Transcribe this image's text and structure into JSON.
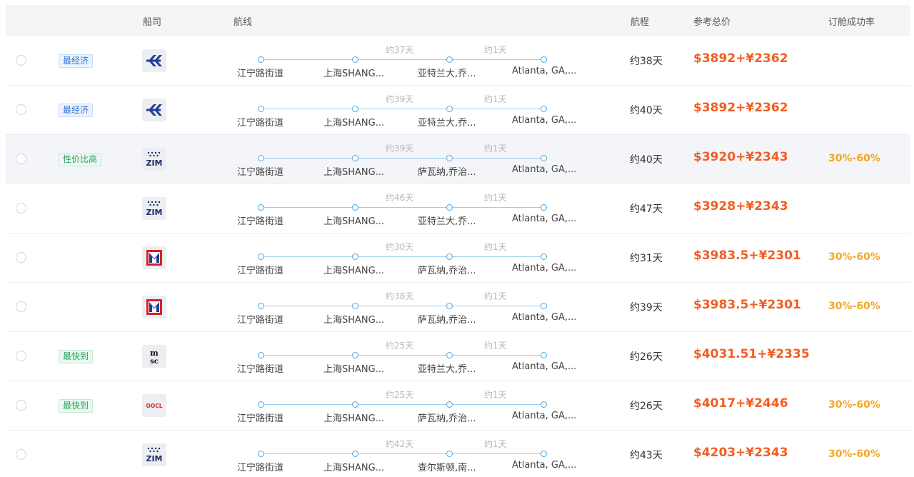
{
  "header": {
    "carrier": "船司",
    "route": "航线",
    "voyage": "航程",
    "price": "参考总价",
    "rate": "订舱成功率"
  },
  "colors": {
    "price": "#f25d22",
    "rate": "#f5a623",
    "tag_blue": "#2f73d6",
    "tag_green": "#2aa35c",
    "route_line": "#4ba8e2"
  },
  "rows": [
    {
      "tag": "最经济",
      "tag_color": "blue",
      "logo": "hapag-lloyd-logo",
      "highlight": false,
      "dur1": "约37天",
      "dur2": "约1天",
      "ports": [
        "江宁路街道",
        "上海SHANG...",
        "亚特兰大,乔...",
        "Atlanta, GA,..."
      ],
      "voyage": "约38天",
      "price": "$3892+¥2362",
      "rate": ""
    },
    {
      "tag": "最经济",
      "tag_color": "blue",
      "logo": "hapag-lloyd-logo",
      "highlight": false,
      "dur1": "约39天",
      "dur2": "约1天",
      "ports": [
        "江宁路街道",
        "上海SHANG...",
        "亚特兰大,乔...",
        "Atlanta, GA,..."
      ],
      "voyage": "约40天",
      "price": "$3892+¥2362",
      "rate": ""
    },
    {
      "tag": "性价比高",
      "tag_color": "green",
      "logo": "zim-logo",
      "highlight": true,
      "dur1": "约39天",
      "dur2": "约1天",
      "ports": [
        "江宁路街道",
        "上海SHANG...",
        "萨瓦纳,乔治...",
        "Atlanta, GA,..."
      ],
      "voyage": "约40天",
      "price": "$3920+¥2343",
      "rate": "30%-60%"
    },
    {
      "tag": "",
      "tag_color": "",
      "logo": "zim-logo",
      "highlight": false,
      "dur1": "约46天",
      "dur2": "约1天",
      "ports": [
        "江宁路街道",
        "上海SHANG...",
        "亚特兰大,乔...",
        "Atlanta, GA,..."
      ],
      "voyage": "约47天",
      "price": "$3928+¥2343",
      "rate": ""
    },
    {
      "tag": "",
      "tag_color": "",
      "logo": "yang-ming-logo",
      "highlight": false,
      "dur1": "约30天",
      "dur2": "约1天",
      "ports": [
        "江宁路街道",
        "上海SHANG...",
        "萨瓦纳,乔治...",
        "Atlanta, GA,..."
      ],
      "voyage": "约31天",
      "price": "$3983.5+¥2301",
      "rate": "30%-60%"
    },
    {
      "tag": "",
      "tag_color": "",
      "logo": "yang-ming-logo",
      "highlight": false,
      "dur1": "约38天",
      "dur2": "约1天",
      "ports": [
        "江宁路街道",
        "上海SHANG...",
        "萨瓦纳,乔治...",
        "Atlanta, GA,..."
      ],
      "voyage": "约39天",
      "price": "$3983.5+¥2301",
      "rate": "30%-60%"
    },
    {
      "tag": "最快到",
      "tag_color": "green",
      "logo": "msc-logo",
      "highlight": false,
      "dur1": "约25天",
      "dur2": "约1天",
      "ports": [
        "江宁路街道",
        "上海SHANG...",
        "亚特兰大,乔...",
        "Atlanta, GA,..."
      ],
      "voyage": "约26天",
      "price": "$4031.51+¥2335",
      "rate": ""
    },
    {
      "tag": "最快到",
      "tag_color": "green",
      "logo": "oocl-logo",
      "highlight": false,
      "dur1": "约25天",
      "dur2": "约1天",
      "ports": [
        "江宁路街道",
        "上海SHANG...",
        "萨瓦纳,乔治...",
        "Atlanta, GA,..."
      ],
      "voyage": "约26天",
      "price": "$4017+¥2446",
      "rate": "30%-60%"
    },
    {
      "tag": "",
      "tag_color": "",
      "logo": "zim-logo",
      "highlight": false,
      "dur1": "约42天",
      "dur2": "约1天",
      "ports": [
        "江宁路街道",
        "上海SHANG...",
        "查尔斯顿,南...",
        "Atlanta, GA,..."
      ],
      "voyage": "约43天",
      "price": "$4203+¥2343",
      "rate": "30%-60%"
    }
  ]
}
